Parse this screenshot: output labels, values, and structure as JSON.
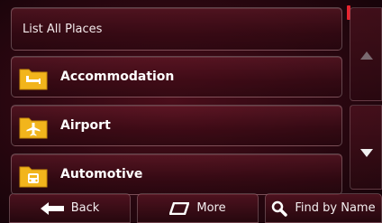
{
  "header": {
    "label": "List All Places"
  },
  "categories": [
    {
      "label": "Accommodation",
      "icon": "bed-icon"
    },
    {
      "label": "Airport",
      "icon": "airplane-icon"
    },
    {
      "label": "Automotive",
      "icon": "car-icon"
    }
  ],
  "scroll": {
    "up_icon": "chevron-up-icon",
    "down_icon": "chevron-down-icon"
  },
  "footer": {
    "back_label": "Back",
    "more_label": "More",
    "find_label": "Find by Name"
  },
  "colors": {
    "accent": "#e8242f",
    "folder": "#f2b51c",
    "background": "#2a0710"
  }
}
